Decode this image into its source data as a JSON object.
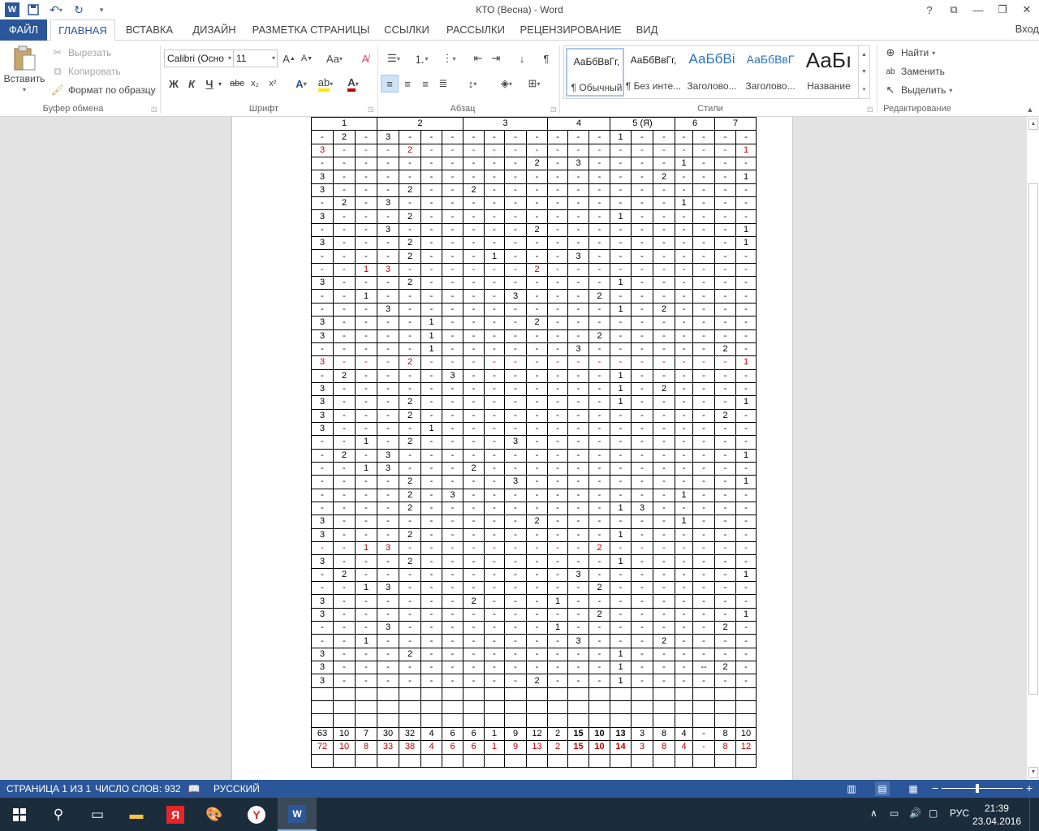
{
  "window": {
    "title": "КТО (Весна) - Word",
    "sign_in": "Вход"
  },
  "tabs": [
    "ФАЙЛ",
    "ГЛАВНАЯ",
    "ВСТАВКА",
    "ДИЗАЙН",
    "РАЗМЕТКА СТРАНИЦЫ",
    "ССЫЛКИ",
    "РАССЫЛКИ",
    "РЕЦЕНЗИРОВАНИЕ",
    "ВИД"
  ],
  "ribbon": {
    "clipboard": {
      "paste": "Вставить",
      "cut": "Вырезать",
      "copy": "Копировать",
      "format_painter": "Формат по образцу",
      "label": "Буфер обмена"
    },
    "font": {
      "font_name": "Calibri (Осно",
      "font_size": "11",
      "label": "Шрифт"
    },
    "paragraph": {
      "label": "Абзац"
    },
    "styles": {
      "label": "Стили",
      "items": [
        {
          "preview": "АаБбВвГг,",
          "name": "¶ Обычный"
        },
        {
          "preview": "АаБбВвГг,",
          "name": "¶ Без инте..."
        },
        {
          "preview": "АаБбВі",
          "name": "Заголово..."
        },
        {
          "preview": "АаБбВвГ",
          "name": "Заголово..."
        },
        {
          "preview": "АаБı",
          "name": "Название"
        }
      ]
    },
    "editing": {
      "find": "Найти",
      "replace": "Заменить",
      "select": "Выделить",
      "label": "Редактирование"
    }
  },
  "table": {
    "header": [
      "1",
      "2",
      "3",
      "4",
      "5 (Я)",
      "6",
      "7"
    ],
    "rows": [
      [
        "-",
        "2",
        "-",
        "3",
        "-",
        "-",
        "-",
        "-",
        "-",
        "-",
        "-",
        "-",
        "-",
        "-",
        "1",
        "-",
        "-",
        "-",
        "-",
        "-",
        "-"
      ],
      [
        "3",
        "-",
        "-",
        "-",
        "2",
        "-",
        "-",
        "-",
        "-",
        "-",
        "-",
        "-",
        "-",
        "-",
        "-",
        "-",
        "-",
        "-",
        "-",
        "-",
        "1"
      ],
      [
        "-",
        "-",
        "-",
        "-",
        "-",
        "-",
        "-",
        "-",
        "-",
        "-",
        "2",
        "-",
        "3",
        "-",
        "-",
        "-",
        "-",
        "1",
        "-",
        "-",
        "-"
      ],
      [
        "3",
        "-",
        "-",
        "-",
        "-",
        "-",
        "-",
        "-",
        "-",
        "-",
        "-",
        "-",
        "-",
        "-",
        "-",
        "-",
        "2",
        "-",
        "-",
        "-",
        "1"
      ],
      [
        "3",
        "-",
        "-",
        "-",
        "2",
        "-",
        "-",
        "2",
        "-",
        "-",
        "-",
        "-",
        "-",
        "-",
        "-",
        "-",
        "-",
        "-",
        "-",
        "-",
        "-"
      ],
      [
        "-",
        "2",
        "-",
        "3",
        "-",
        "-",
        "-",
        "-",
        "-",
        "-",
        "-",
        "-",
        "-",
        "-",
        "-",
        "-",
        "-",
        "1",
        "-",
        "-",
        "-"
      ],
      [
        "3",
        "-",
        "-",
        "-",
        "2",
        "-",
        "-",
        "-",
        "-",
        "-",
        "-",
        "-",
        "-",
        "-",
        "1",
        "-",
        "-",
        "-",
        "-",
        "-",
        "-"
      ],
      [
        "-",
        "-",
        "-",
        "3",
        "-",
        "-",
        "-",
        "-",
        "-",
        "-",
        "2",
        "-",
        "-",
        "-",
        "-",
        "-",
        "-",
        "-",
        "-",
        "-",
        "1"
      ],
      [
        "3",
        "-",
        "-",
        "-",
        "2",
        "-",
        "-",
        "-",
        "-",
        "-",
        "-",
        "-",
        "-",
        "-",
        "-",
        "-",
        "-",
        "-",
        "-",
        "-",
        "1"
      ],
      [
        "-",
        "-",
        "-",
        "-",
        "2",
        "-",
        "-",
        "-",
        "1",
        "-",
        "-",
        "-",
        "3",
        "-",
        "-",
        "-",
        "-",
        "-",
        "-",
        "-",
        "-"
      ],
      [
        "-",
        "-",
        "1",
        "3",
        "-",
        "-",
        "-",
        "-",
        "-",
        "-",
        "2",
        "-",
        "-",
        "-",
        "-",
        "-",
        "-",
        "-",
        "-",
        "-",
        "-"
      ],
      [
        "3",
        "-",
        "-",
        "-",
        "2",
        "-",
        "-",
        "-",
        "-",
        "-",
        "-",
        "-",
        "-",
        "-",
        "1",
        "-",
        "-",
        "-",
        "-",
        "-",
        "-"
      ],
      [
        "-",
        "-",
        "1",
        "-",
        "-",
        "-",
        "-",
        "-",
        "-",
        "3",
        "-",
        "-",
        "-",
        "2",
        "-",
        "-",
        "-",
        "-",
        "-",
        "-",
        "-"
      ],
      [
        "-",
        "-",
        "-",
        "3",
        "-",
        "-",
        "-",
        "-",
        "-",
        "-",
        "-",
        "-",
        "-",
        "-",
        "1",
        "-",
        "2",
        "-",
        "-",
        "-",
        "-"
      ],
      [
        "3",
        "-",
        "-",
        "-",
        "-",
        "1",
        "-",
        "-",
        "-",
        "-",
        "2",
        "-",
        "-",
        "-",
        "-",
        "-",
        "-",
        "-",
        "-",
        "-",
        "-"
      ],
      [
        "3",
        "-",
        "-",
        "-",
        "-",
        "1",
        "-",
        "-",
        "-",
        "-",
        "-",
        "-",
        "-",
        "2",
        "-",
        "-",
        "-",
        "-",
        "-",
        "-",
        "-"
      ],
      [
        "-",
        "-",
        "-",
        "-",
        "-",
        "1",
        "-",
        "-",
        "-",
        "-",
        "-",
        "-",
        "3",
        "-",
        "-",
        "-",
        "-",
        "-",
        "-",
        "2",
        "-"
      ],
      [
        "3",
        "-",
        "-",
        "-",
        "2",
        "-",
        "-",
        "-",
        "-",
        "-",
        "-",
        "-",
        "-",
        "-",
        "-",
        "-",
        "-",
        "-",
        "-",
        "-",
        "1"
      ],
      [
        "-",
        "2",
        "-",
        "-",
        "-",
        "-",
        "3",
        "-",
        "-",
        "-",
        "-",
        "-",
        "-",
        "-",
        "1",
        "-",
        "-",
        "-",
        "-",
        "-",
        "-"
      ],
      [
        "3",
        "-",
        "-",
        "-",
        "-",
        "-",
        "-",
        "-",
        "-",
        "-",
        "-",
        "-",
        "-",
        "-",
        "1",
        "-",
        "2",
        "-",
        "-",
        "-",
        "-"
      ],
      [
        "3",
        "-",
        "-",
        "-",
        "2",
        "-",
        "-",
        "-",
        "-",
        "-",
        "-",
        "-",
        "-",
        "-",
        "1",
        "-",
        "-",
        "-",
        "-",
        "-",
        "1"
      ],
      [
        "3",
        "-",
        "-",
        "-",
        "2",
        "-",
        "-",
        "-",
        "-",
        "-",
        "-",
        "-",
        "-",
        "-",
        "-",
        "-",
        "-",
        "-",
        "-",
        "2",
        "-"
      ],
      [
        "3",
        "-",
        "-",
        "-",
        "-",
        "1",
        "-",
        "-",
        "-",
        "-",
        "-",
        "-",
        "-",
        "-",
        "-",
        "-",
        "-",
        "-",
        "-",
        "-",
        "-"
      ],
      [
        "-",
        "-",
        "1",
        "-",
        "2",
        "-",
        "-",
        "-",
        "-",
        "3",
        "-",
        "-",
        "-",
        "-",
        "-",
        "-",
        "-",
        "-",
        "-",
        "-",
        "-"
      ],
      [
        "-",
        "2",
        "-",
        "3",
        "-",
        "-",
        "-",
        "-",
        "-",
        "-",
        "-",
        "-",
        "-",
        "-",
        "-",
        "-",
        "-",
        "-",
        "-",
        "-",
        "1"
      ],
      [
        "-",
        "-",
        "1",
        "3",
        "-",
        "-",
        "-",
        "2",
        "-",
        "-",
        "-",
        "-",
        "-",
        "-",
        "-",
        "-",
        "-",
        "-",
        "-",
        "-",
        "-"
      ],
      [
        "-",
        "-",
        "-",
        "-",
        "2",
        "-",
        "-",
        "-",
        "-",
        "3",
        "-",
        "-",
        "-",
        "-",
        "-",
        "-",
        "-",
        "-",
        "-",
        "-",
        "1"
      ],
      [
        "-",
        "-",
        "-",
        "-",
        "2",
        "-",
        "3",
        "-",
        "-",
        "-",
        "-",
        "-",
        "-",
        "-",
        "-",
        "-",
        "-",
        "1",
        "-",
        "-",
        "-"
      ],
      [
        "-",
        "-",
        "-",
        "-",
        "2",
        "-",
        "-",
        "-",
        "-",
        "-",
        "-",
        "-",
        "-",
        "-",
        "1",
        "3",
        "-",
        "-",
        "-",
        "-",
        "-"
      ],
      [
        "3",
        "-",
        "-",
        "-",
        "-",
        "-",
        "-",
        "-",
        "-",
        "-",
        "2",
        "-",
        "-",
        "-",
        "-",
        "-",
        "-",
        "1",
        "-",
        "-",
        "-"
      ],
      [
        "3",
        "-",
        "-",
        "-",
        "2",
        "-",
        "-",
        "-",
        "-",
        "-",
        "-",
        "-",
        "-",
        "-",
        "1",
        "-",
        "-",
        "-",
        "-",
        "-",
        "-"
      ],
      [
        "-",
        "-",
        "1",
        "3",
        "-",
        "-",
        "-",
        "-",
        "-",
        "-",
        "-",
        "-",
        "-",
        "2",
        "-",
        "-",
        "-",
        "-",
        "-",
        "-",
        "-"
      ],
      [
        "3",
        "-",
        "-",
        "-",
        "2",
        "-",
        "-",
        "-",
        "-",
        "-",
        "-",
        "-",
        "-",
        "-",
        "1",
        "-",
        "-",
        "-",
        "-",
        "-",
        "-"
      ],
      [
        "-",
        "2",
        "-",
        "-",
        "-",
        "-",
        "-",
        "-",
        "-",
        "-",
        "-",
        "-",
        "3",
        "-",
        "-",
        "-",
        "-",
        "-",
        "-",
        "-",
        "1"
      ],
      [
        "-",
        "-",
        "1",
        "3",
        "-",
        "-",
        "-",
        "-",
        "-",
        "-",
        "-",
        "-",
        "-",
        "2",
        "-",
        "-",
        "-",
        "-",
        "-",
        "-",
        "-"
      ],
      [
        "3",
        "-",
        "-",
        "-",
        "-",
        "-",
        "-",
        "2",
        "-",
        "-",
        "-",
        "1",
        "-",
        "-",
        "-",
        "-",
        "-",
        "-",
        "-",
        "-",
        "-"
      ],
      [
        "3",
        "-",
        "-",
        "-",
        "-",
        "-",
        "-",
        "-",
        "-",
        "-",
        "-",
        "-",
        "-",
        "2",
        "-",
        "-",
        "-",
        "-",
        "-",
        "-",
        "1"
      ],
      [
        "-",
        "-",
        "-",
        "3",
        "-",
        "-",
        "-",
        "-",
        "-",
        "-",
        "-",
        "1",
        "-",
        "-",
        "-",
        "-",
        "-",
        "-",
        "-",
        "2",
        "-"
      ],
      [
        "-",
        "-",
        "1",
        "-",
        "-",
        "-",
        "-",
        "-",
        "-",
        "-",
        "-",
        "-",
        "3",
        "-",
        "-",
        "-",
        "2",
        "-",
        "-",
        "-",
        "-"
      ],
      [
        "3",
        "-",
        "-",
        "-",
        "2",
        "-",
        "-",
        "-",
        "-",
        "-",
        "-",
        "-",
        "-",
        "-",
        "1",
        "-",
        "-",
        "-",
        "-",
        "-",
        "-"
      ],
      [
        "3",
        "-",
        "-",
        "-",
        "-",
        "-",
        "-",
        "-",
        "-",
        "-",
        "-",
        "-",
        "-",
        "-",
        "1",
        "-",
        "-",
        "-",
        "--",
        "2",
        "-"
      ],
      [
        "3",
        "-",
        "-",
        "-",
        "-",
        "-",
        "-",
        "-",
        "-",
        "-",
        "2",
        "-",
        "-",
        "-",
        "1",
        "-",
        "-",
        "-",
        "-",
        "-",
        "-"
      ]
    ],
    "red_rows": [
      1,
      10,
      17,
      31
    ],
    "totals": [
      "63",
      "10",
      "7",
      "30",
      "32",
      "4",
      "6",
      "6",
      "1",
      "9",
      "12",
      "2",
      "15",
      "10",
      "13",
      "3",
      "8",
      "4",
      "-",
      "8",
      "10"
    ],
    "totals_red": [
      "72",
      "10",
      "8",
      "33",
      "38",
      "4",
      "6",
      "6",
      "1",
      "9",
      "13",
      "2",
      "15",
      "10",
      "14",
      "3",
      "8",
      "4",
      "-",
      "8",
      "12"
    ]
  },
  "status": {
    "page": "СТРАНИЦА 1 ИЗ 1",
    "words": "ЧИСЛО СЛОВ: 932",
    "language": "РУССКИЙ"
  },
  "taskbar": {
    "lang": "РУС",
    "time": "21:39",
    "date": "23.04.2016"
  },
  "colors": {
    "word_blue": "#2b579a",
    "red_text": "#c00000",
    "taskbar": "#1b2c3b"
  }
}
